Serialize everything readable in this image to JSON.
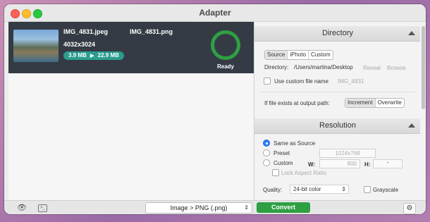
{
  "window": {
    "title": "Adapter"
  },
  "file": {
    "source_name": "IMG_4831.jpeg",
    "output_name": "IMG_4831.png",
    "dimensions": "4032x3024",
    "size_from": "3.9 MB",
    "size_to": "22.9 MB",
    "status": "Ready",
    "progress": 1.0
  },
  "directory": {
    "header": "Directory",
    "tabs": [
      "Source",
      "iPhoto",
      "Custom"
    ],
    "path_label": "Directory:",
    "path": "/Users/martina/Desktop",
    "reveal": "Reveal",
    "browse": "Browse",
    "custom_name_label": "Use custom file name",
    "custom_name_placeholder": "IMG_4831",
    "exists_label": "If file exists at output path:",
    "exists_options": [
      "Increment",
      "Overwrite"
    ]
  },
  "resolution": {
    "header": "Resolution",
    "same_label": "Same as Source",
    "preset_label": "Preset",
    "preset_value": "1024x768",
    "custom_label": "Custom",
    "w_label": "W:",
    "w_value": "800",
    "h_label": "H:",
    "h_value": "*",
    "lock_label": "Lock Aspect Ratio",
    "quality_label": "Quality:",
    "quality_value": "24-bit color",
    "grayscale_label": "Grayscale"
  },
  "toolbar": {
    "format": "Image > PNG (.png)",
    "convert": "Convert"
  },
  "colors": {
    "accent": "#2ea043",
    "row_bg": "#353b45",
    "size_badge": "#2a9d8f",
    "radio_on": "#2d7ff9"
  }
}
